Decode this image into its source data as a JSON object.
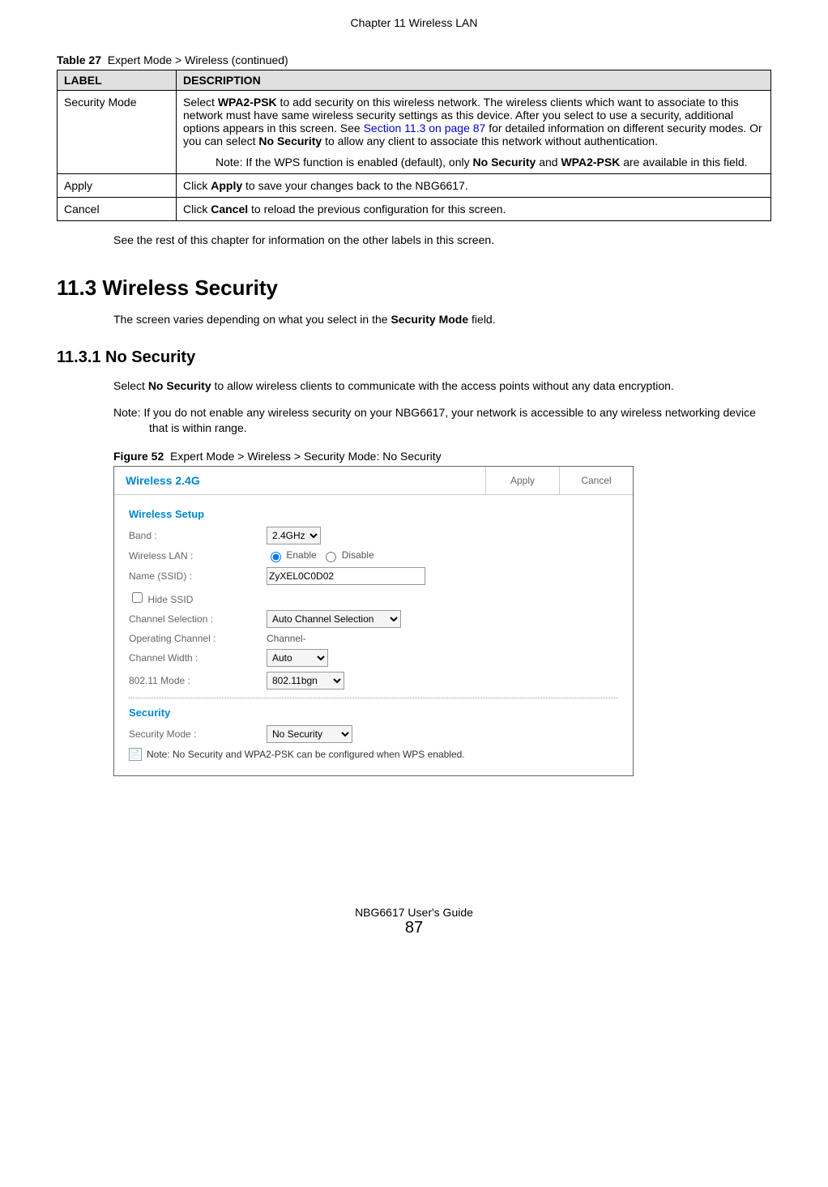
{
  "header": {
    "chapter": "Chapter 11 Wireless LAN"
  },
  "table27": {
    "caption_prefix": "Table 27",
    "caption_text": "Expert Mode > Wireless (continued)",
    "col_label": "LABEL",
    "col_desc": "DESCRIPTION",
    "rows": {
      "security_mode": {
        "label": "Security Mode",
        "desc_pre": "Select ",
        "desc_b1": "WPA2-PSK",
        "desc_mid1": " to add security on this wireless network. The wireless clients which want to associate to this network must have same wireless security settings as this device. After you select to use a security, additional options appears in this screen. See ",
        "link": "Section 11.3 on page 87",
        "desc_mid2": " for detailed information on different security modes. Or you can select ",
        "desc_b2": "No Security",
        "desc_post": " to allow any client to associate this network without authentication.",
        "note_pre": "Note: If the WPS function is enabled (default), only ",
        "note_b1": "No Security",
        "note_mid": " and ",
        "note_b2": "WPA2-PSK",
        "note_post": " are available in this field."
      },
      "apply": {
        "label": "Apply",
        "desc_pre": "Click ",
        "desc_b": "Apply",
        "desc_post": " to save your changes back to the NBG6617."
      },
      "cancel": {
        "label": "Cancel",
        "desc_pre": "Click ",
        "desc_b": "Cancel",
        "desc_post": " to reload the previous configuration for this screen."
      }
    }
  },
  "after_table_para": "See the rest of this chapter for information on the other labels in this screen.",
  "section_11_3": {
    "heading": "11.3  Wireless Security",
    "para_pre": "The screen varies depending on what you select in the ",
    "para_b": "Security Mode",
    "para_post": " field."
  },
  "section_11_3_1": {
    "heading": "11.3.1  No Security",
    "para_pre": "Select ",
    "para_b": "No Security",
    "para_post": " to allow wireless clients to communicate with the access points without any data encryption.",
    "note": "Note: If you do not enable any wireless security on your NBG6617, your network is accessible to any wireless networking device that is within range."
  },
  "figure52": {
    "caption_prefix": "Figure 52",
    "caption_text": "Expert Mode > Wireless > Security Mode: No Security"
  },
  "ui": {
    "title": "Wireless 2.4G",
    "apply": "Apply",
    "cancel": "Cancel",
    "section_wireless_setup": "Wireless Setup",
    "band_label": "Band :",
    "band_value": "2.4GHz",
    "wlan_label": "Wireless LAN :",
    "wlan_enable": "Enable",
    "wlan_disable": "Disable",
    "ssid_label": "Name (SSID) :",
    "ssid_value": "ZyXEL0C0D02",
    "hide_ssid": "Hide SSID",
    "chan_sel_label": "Channel Selection :",
    "chan_sel_value": "Auto Channel Selection",
    "op_chan_label": "Operating Channel :",
    "op_chan_value": "Channel-",
    "chan_width_label": "Channel Width :",
    "chan_width_value": "Auto",
    "mode_label": "802.11 Mode :",
    "mode_value": "802.11bgn",
    "section_security": "Security",
    "sec_mode_label": "Security Mode :",
    "sec_mode_value": "No Security",
    "note_text": "Note: No Security and WPA2-PSK can be configured when WPS enabled."
  },
  "footer": {
    "guide": "NBG6617 User's Guide",
    "page": "87"
  }
}
